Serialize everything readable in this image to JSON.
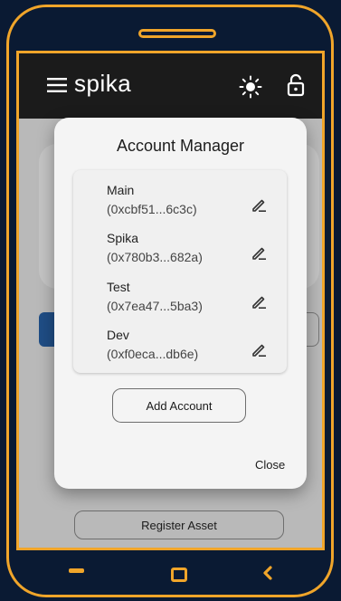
{
  "app": {
    "brand": "spika"
  },
  "background": {
    "register_label": "Register Asset"
  },
  "dialog": {
    "title": "Account Manager",
    "accounts": [
      {
        "name": "Main",
        "address": "(0xcbf51...6c3c)"
      },
      {
        "name": "Spika",
        "address": "(0x780b3...682a)"
      },
      {
        "name": "Test",
        "address": "(0x7ea47...5ba3)"
      },
      {
        "name": "Dev",
        "address": "(0xf0eca...db6e)"
      }
    ],
    "add_label": "Add Account",
    "close_label": "Close"
  },
  "icons": {
    "menu": "menu-icon",
    "theme": "sun-icon",
    "lock": "lock-icon",
    "edit": "pencil-icon"
  },
  "colors": {
    "frame": "#f0a52a",
    "outer_bg": "#0a1a33",
    "appbar": "#1b1b1b",
    "dialog": "#f4f4f4"
  }
}
